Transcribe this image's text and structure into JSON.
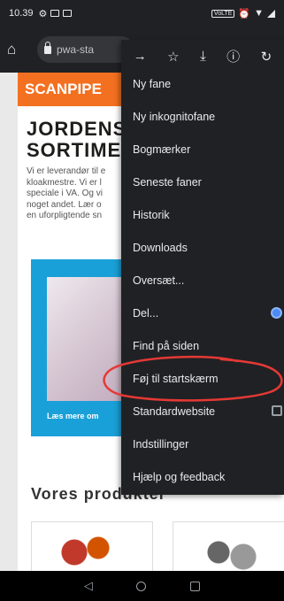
{
  "status_bar": {
    "time": "10.39",
    "volte": "VoLTE"
  },
  "toolbar": {
    "url": "pwa-sta"
  },
  "page": {
    "brand": "SCANPIPE",
    "headline_line1": "JORDENS",
    "headline_line2": "SORTIME",
    "para_lines": [
      "Vi er leverandør til e",
      "kloakmestre. Vi er l",
      "speciale i VA. Og vi",
      "noget andet. Lær o",
      "en uforpligtende sn"
    ],
    "hero_cta": "Læs mere om",
    "products_heading": "Vores produkter"
  },
  "menu": {
    "items": [
      {
        "label": "Ny fane"
      },
      {
        "label": "Ny inkognitofane"
      },
      {
        "label": "Bogmærker"
      },
      {
        "label": "Seneste faner"
      },
      {
        "label": "Historik"
      },
      {
        "label": "Downloads"
      },
      {
        "label": "Oversæt..."
      },
      {
        "label": "Del..."
      },
      {
        "label": "Find på siden"
      },
      {
        "label": "Føj til startskærm"
      },
      {
        "label": "Standardwebsite"
      },
      {
        "label": "Indstillinger"
      },
      {
        "label": "Hjælp og feedback"
      }
    ]
  },
  "colors": {
    "menu_bg": "#202124",
    "brand_orange": "#f37021",
    "hero_blue": "#1aa0d8",
    "annotation_red": "#e53935"
  }
}
